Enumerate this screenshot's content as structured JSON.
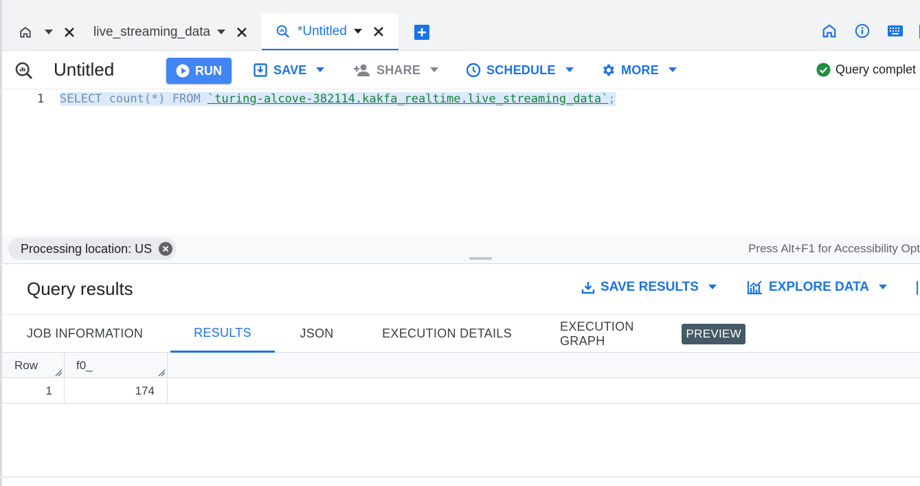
{
  "tabs": [
    {
      "label": "",
      "kind": "home"
    },
    {
      "label": "live_streaming_data",
      "kind": "table"
    },
    {
      "label": "*Untitled",
      "kind": "query",
      "active": true
    }
  ],
  "toolbar": {
    "query_title": "Untitled",
    "run_label": "RUN",
    "save_label": "SAVE",
    "share_label": "SHARE",
    "schedule_label": "SCHEDULE",
    "more_label": "MORE",
    "status_text": "Query complet"
  },
  "editor": {
    "line_number": "1",
    "code_keyword_select": "SELECT",
    "code_mid": " count(*) ",
    "code_keyword_from": "FROM",
    "code_space": " ",
    "code_table": "`turing-alcove-382114.kakfa_realtime.live_streaming_data`",
    "code_end": ";"
  },
  "strip": {
    "processing_location": "Processing location: US",
    "accessibility_hint": "Press Alt+F1 for Accessibility Opt"
  },
  "results": {
    "title": "Query results",
    "save_results_label": "SAVE RESULTS",
    "explore_data_label": "EXPLORE DATA",
    "subtabs": [
      "JOB INFORMATION",
      "RESULTS",
      "JSON",
      "EXECUTION DETAILS",
      "EXECUTION GRAPH"
    ],
    "preview_badge": "PREVIEW",
    "columns": [
      "Row",
      "f0_"
    ],
    "rows": [
      [
        "1",
        "174"
      ]
    ]
  },
  "colors": {
    "accent": "#1a73e8",
    "run_button": "#4285f4",
    "success": "#1e8e3e"
  },
  "icons": [
    "home-icon",
    "info-icon",
    "keyboard-icon",
    "query-icon",
    "add-tab-icon",
    "play-icon",
    "save-icon",
    "person-add-icon",
    "clock-icon",
    "gear-icon",
    "check-circle-icon",
    "download-icon",
    "chart-icon"
  ]
}
